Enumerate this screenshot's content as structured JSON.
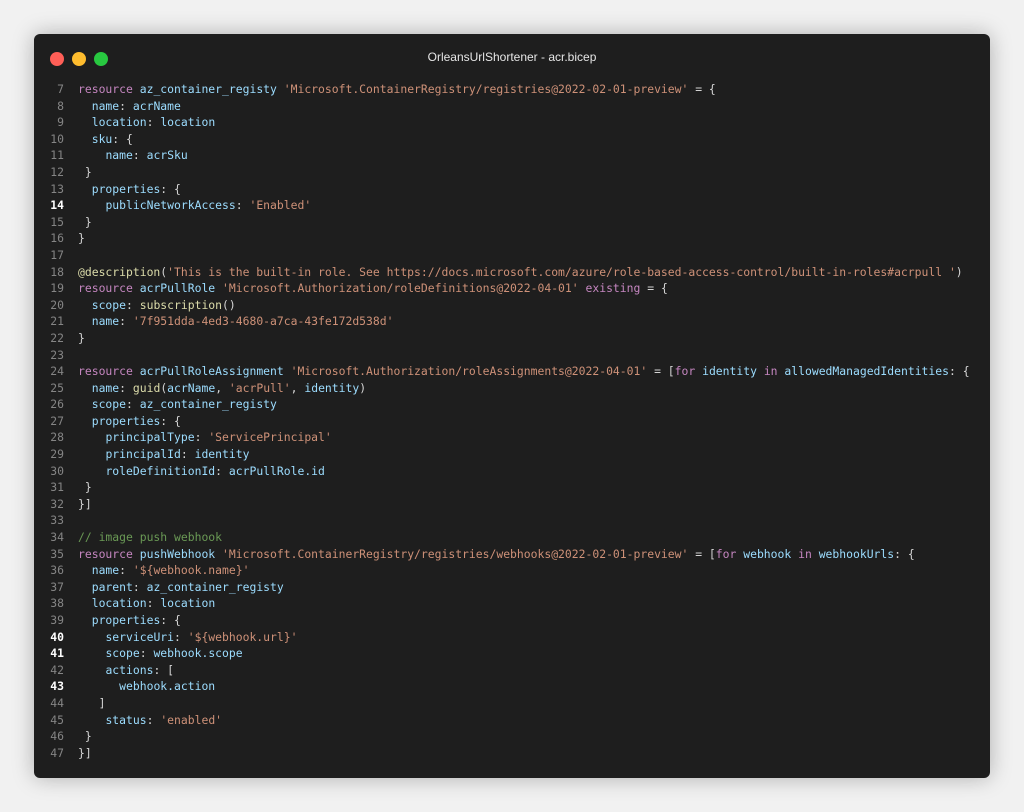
{
  "window": {
    "title": "OrleansUrlShortener - acr.bicep"
  },
  "editor": {
    "active_lines": [
      "14",
      "40",
      "41",
      "43"
    ],
    "lines": [
      {
        "n": "7",
        "t": [
          [
            "kw",
            "resource"
          ],
          [
            "pn",
            " "
          ],
          [
            "id",
            "az_container_registy"
          ],
          [
            "pn",
            " "
          ],
          [
            "str",
            "'Microsoft.ContainerRegistry/registries@2022-02-01-preview'"
          ],
          [
            "pn",
            " = {"
          ]
        ]
      },
      {
        "n": "8",
        "t": [
          [
            "pn",
            "  "
          ],
          [
            "id",
            "name"
          ],
          [
            "pn",
            ": "
          ],
          [
            "id",
            "acrName"
          ]
        ]
      },
      {
        "n": "9",
        "t": [
          [
            "pn",
            "  "
          ],
          [
            "id",
            "location"
          ],
          [
            "pn",
            ": "
          ],
          [
            "id",
            "location"
          ]
        ]
      },
      {
        "n": "10",
        "t": [
          [
            "pn",
            "  "
          ],
          [
            "id",
            "sku"
          ],
          [
            "pn",
            ": {"
          ]
        ]
      },
      {
        "n": "11",
        "t": [
          [
            "pn",
            "    "
          ],
          [
            "id",
            "name"
          ],
          [
            "pn",
            ": "
          ],
          [
            "id",
            "acrSku"
          ]
        ]
      },
      {
        "n": "12",
        "t": [
          [
            "pn",
            " }"
          ]
        ]
      },
      {
        "n": "13",
        "t": [
          [
            "pn",
            "  "
          ],
          [
            "id",
            "properties"
          ],
          [
            "pn",
            ": {"
          ]
        ]
      },
      {
        "n": "14",
        "t": [
          [
            "pn",
            "    "
          ],
          [
            "id",
            "publicNetworkAccess"
          ],
          [
            "pn",
            ": "
          ],
          [
            "str",
            "'Enabled'"
          ]
        ]
      },
      {
        "n": "15",
        "t": [
          [
            "pn",
            " }"
          ]
        ]
      },
      {
        "n": "16",
        "t": [
          [
            "pn",
            "}"
          ]
        ]
      },
      {
        "n": "17",
        "t": []
      },
      {
        "n": "18",
        "t": [
          [
            "fn",
            "@description"
          ],
          [
            "pn",
            "("
          ],
          [
            "str",
            "'This is the built-in role. See https://docs.microsoft.com/azure/role-based-access-control/built-in-roles#acrpull '"
          ],
          [
            "pn",
            ")"
          ]
        ]
      },
      {
        "n": "19",
        "t": [
          [
            "kw",
            "resource"
          ],
          [
            "pn",
            " "
          ],
          [
            "id",
            "acrPullRole"
          ],
          [
            "pn",
            " "
          ],
          [
            "str",
            "'Microsoft.Authorization/roleDefinitions@2022-04-01'"
          ],
          [
            "pn",
            " "
          ],
          [
            "kw",
            "existing"
          ],
          [
            "pn",
            " = {"
          ]
        ]
      },
      {
        "n": "20",
        "t": [
          [
            "pn",
            "  "
          ],
          [
            "id",
            "scope"
          ],
          [
            "pn",
            ": "
          ],
          [
            "fn",
            "subscription"
          ],
          [
            "pn",
            "()"
          ]
        ]
      },
      {
        "n": "21",
        "t": [
          [
            "pn",
            "  "
          ],
          [
            "id",
            "name"
          ],
          [
            "pn",
            ": "
          ],
          [
            "str",
            "'7f951dda-4ed3-4680-a7ca-43fe172d538d'"
          ]
        ]
      },
      {
        "n": "22",
        "t": [
          [
            "pn",
            "}"
          ]
        ]
      },
      {
        "n": "23",
        "t": []
      },
      {
        "n": "24",
        "t": [
          [
            "kw",
            "resource"
          ],
          [
            "pn",
            " "
          ],
          [
            "id",
            "acrPullRoleAssignment"
          ],
          [
            "pn",
            " "
          ],
          [
            "str",
            "'Microsoft.Authorization/roleAssignments@2022-04-01'"
          ],
          [
            "pn",
            " = ["
          ],
          [
            "kw",
            "for"
          ],
          [
            "pn",
            " "
          ],
          [
            "id",
            "identity"
          ],
          [
            "pn",
            " "
          ],
          [
            "kw",
            "in"
          ],
          [
            "pn",
            " "
          ],
          [
            "id",
            "allowedManagedIdentities"
          ],
          [
            "pn",
            ": {"
          ]
        ]
      },
      {
        "n": "25",
        "t": [
          [
            "pn",
            "  "
          ],
          [
            "id",
            "name"
          ],
          [
            "pn",
            ": "
          ],
          [
            "fn",
            "guid"
          ],
          [
            "pn",
            "("
          ],
          [
            "id",
            "acrName"
          ],
          [
            "pn",
            ", "
          ],
          [
            "str",
            "'acrPull'"
          ],
          [
            "pn",
            ", "
          ],
          [
            "id",
            "identity"
          ],
          [
            "pn",
            ")"
          ]
        ]
      },
      {
        "n": "26",
        "t": [
          [
            "pn",
            "  "
          ],
          [
            "id",
            "scope"
          ],
          [
            "pn",
            ": "
          ],
          [
            "id",
            "az_container_registy"
          ]
        ]
      },
      {
        "n": "27",
        "t": [
          [
            "pn",
            "  "
          ],
          [
            "id",
            "properties"
          ],
          [
            "pn",
            ": {"
          ]
        ]
      },
      {
        "n": "28",
        "t": [
          [
            "pn",
            "    "
          ],
          [
            "id",
            "principalType"
          ],
          [
            "pn",
            ": "
          ],
          [
            "str",
            "'ServicePrincipal'"
          ]
        ]
      },
      {
        "n": "29",
        "t": [
          [
            "pn",
            "    "
          ],
          [
            "id",
            "principalId"
          ],
          [
            "pn",
            ": "
          ],
          [
            "id",
            "identity"
          ]
        ]
      },
      {
        "n": "30",
        "t": [
          [
            "pn",
            "    "
          ],
          [
            "id",
            "roleDefinitionId"
          ],
          [
            "pn",
            ": "
          ],
          [
            "id",
            "acrPullRole.id"
          ]
        ]
      },
      {
        "n": "31",
        "t": [
          [
            "pn",
            " }"
          ]
        ]
      },
      {
        "n": "32",
        "t": [
          [
            "pn",
            "}]"
          ]
        ]
      },
      {
        "n": "33",
        "t": []
      },
      {
        "n": "34",
        "t": [
          [
            "cm",
            "// image push webhook"
          ]
        ]
      },
      {
        "n": "35",
        "t": [
          [
            "kw",
            "resource"
          ],
          [
            "pn",
            " "
          ],
          [
            "id",
            "pushWebhook"
          ],
          [
            "pn",
            " "
          ],
          [
            "str",
            "'Microsoft.ContainerRegistry/registries/webhooks@2022-02-01-preview'"
          ],
          [
            "pn",
            " = ["
          ],
          [
            "kw",
            "for"
          ],
          [
            "pn",
            " "
          ],
          [
            "id",
            "webhook"
          ],
          [
            "pn",
            " "
          ],
          [
            "kw",
            "in"
          ],
          [
            "pn",
            " "
          ],
          [
            "id",
            "webhookUrls"
          ],
          [
            "pn",
            ": {"
          ]
        ]
      },
      {
        "n": "36",
        "t": [
          [
            "pn",
            "  "
          ],
          [
            "id",
            "name"
          ],
          [
            "pn",
            ": "
          ],
          [
            "str",
            "'${webhook.name}'"
          ]
        ]
      },
      {
        "n": "37",
        "t": [
          [
            "pn",
            "  "
          ],
          [
            "id",
            "parent"
          ],
          [
            "pn",
            ": "
          ],
          [
            "id",
            "az_container_registy"
          ]
        ]
      },
      {
        "n": "38",
        "t": [
          [
            "pn",
            "  "
          ],
          [
            "id",
            "location"
          ],
          [
            "pn",
            ": "
          ],
          [
            "id",
            "location"
          ]
        ]
      },
      {
        "n": "39",
        "t": [
          [
            "pn",
            "  "
          ],
          [
            "id",
            "properties"
          ],
          [
            "pn",
            ": {"
          ]
        ]
      },
      {
        "n": "40",
        "t": [
          [
            "pn",
            "    "
          ],
          [
            "id",
            "serviceUri"
          ],
          [
            "pn",
            ": "
          ],
          [
            "str",
            "'${webhook.url}'"
          ]
        ]
      },
      {
        "n": "41",
        "t": [
          [
            "pn",
            "    "
          ],
          [
            "id",
            "scope"
          ],
          [
            "pn",
            ": "
          ],
          [
            "id",
            "webhook.scope"
          ]
        ]
      },
      {
        "n": "42",
        "t": [
          [
            "pn",
            "    "
          ],
          [
            "id",
            "actions"
          ],
          [
            "pn",
            ": ["
          ]
        ]
      },
      {
        "n": "43",
        "t": [
          [
            "pn",
            "      "
          ],
          [
            "id",
            "webhook.action"
          ]
        ]
      },
      {
        "n": "44",
        "t": [
          [
            "pn",
            "   ]"
          ]
        ]
      },
      {
        "n": "45",
        "t": [
          [
            "pn",
            "    "
          ],
          [
            "id",
            "status"
          ],
          [
            "pn",
            ": "
          ],
          [
            "str",
            "'enabled'"
          ]
        ]
      },
      {
        "n": "46",
        "t": [
          [
            "pn",
            " }"
          ]
        ]
      },
      {
        "n": "47",
        "t": [
          [
            "pn",
            "}]"
          ]
        ]
      }
    ]
  }
}
